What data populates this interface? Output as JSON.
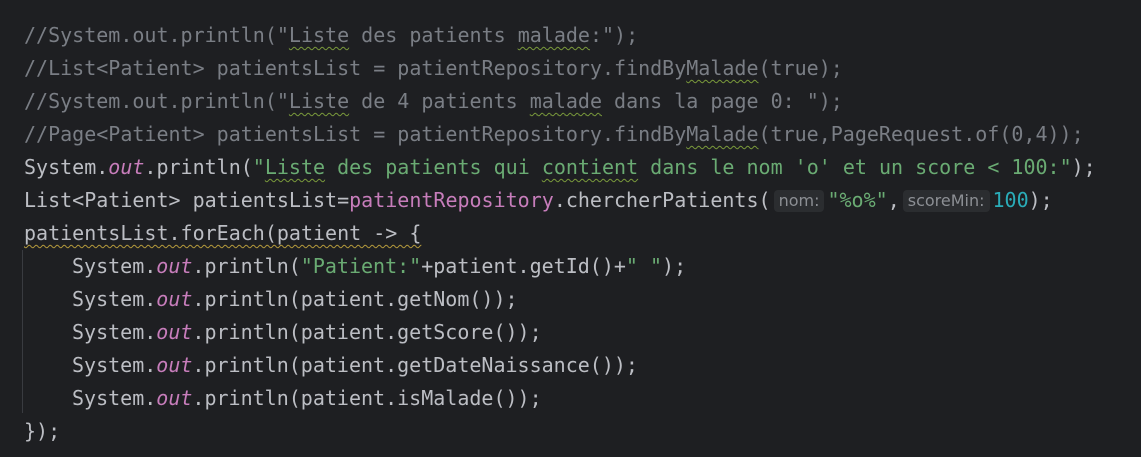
{
  "editor": {
    "line1": {
      "a": "//System.out.println(\"",
      "b": "Liste",
      "c": " des patients ",
      "d": "malade",
      "e": ":\");"
    },
    "line2": {
      "a": "//List<Patient> patientsList = patientRepository.findBy",
      "b": "Malade",
      "c": "(true);"
    },
    "line3": {
      "a": "//System.out.println(\"",
      "b": "Liste",
      "c": " de 4 patients ",
      "d": "malade",
      "e": " dans la page 0: \");"
    },
    "line4": {
      "a": "//Page<Patient> patientsList = patientRepository.findBy",
      "b": "Malade",
      "c": "(true,PageRequest.of(0,4));"
    },
    "line5": {
      "a": "System.",
      "b": "out",
      "c": ".println(",
      "d": "\"",
      "e": "Liste",
      "f": " des patients qui ",
      "g": "contient",
      "h": " dans le nom 'o' et un score < 100:\"",
      "i": ");"
    },
    "line6": {
      "a": "List<Patient> patientsList=",
      "b": "patientRepository",
      "c": ".chercherPatients(",
      "hint_nom": "nom:",
      "d": "\"%o%\"",
      "e": ",",
      "hint_score": "scoreMin:",
      "f": "100",
      "g": ");"
    },
    "line7": {
      "a": "patientsList.forEach(patient -> {"
    },
    "line8": {
      "a": "System.",
      "b": "out",
      "c": ".println(",
      "d": "\"Patient:\"",
      "e": "+patient.getId()+",
      "f": "\" \"",
      "g": ");"
    },
    "line9": {
      "a": "System.",
      "b": "out",
      "c": ".println(patient.getNom());"
    },
    "line10": {
      "a": "System.",
      "b": "out",
      "c": ".println(patient.getScore());"
    },
    "line11": {
      "a": "System.",
      "b": "out",
      "c": ".println(patient.getDateNaissance());"
    },
    "line12": {
      "a": "System.",
      "b": "out",
      "c": ".println(patient.isMalade());"
    },
    "line13": {
      "a": "});"
    }
  },
  "colors": {
    "background": "#1e1f22",
    "comment": "#7a7e85",
    "plain": "#bcbec4",
    "field": "#c77dbb",
    "string": "#6aab73",
    "number": "#2aacb8",
    "hint_bg": "#2b2d30"
  }
}
